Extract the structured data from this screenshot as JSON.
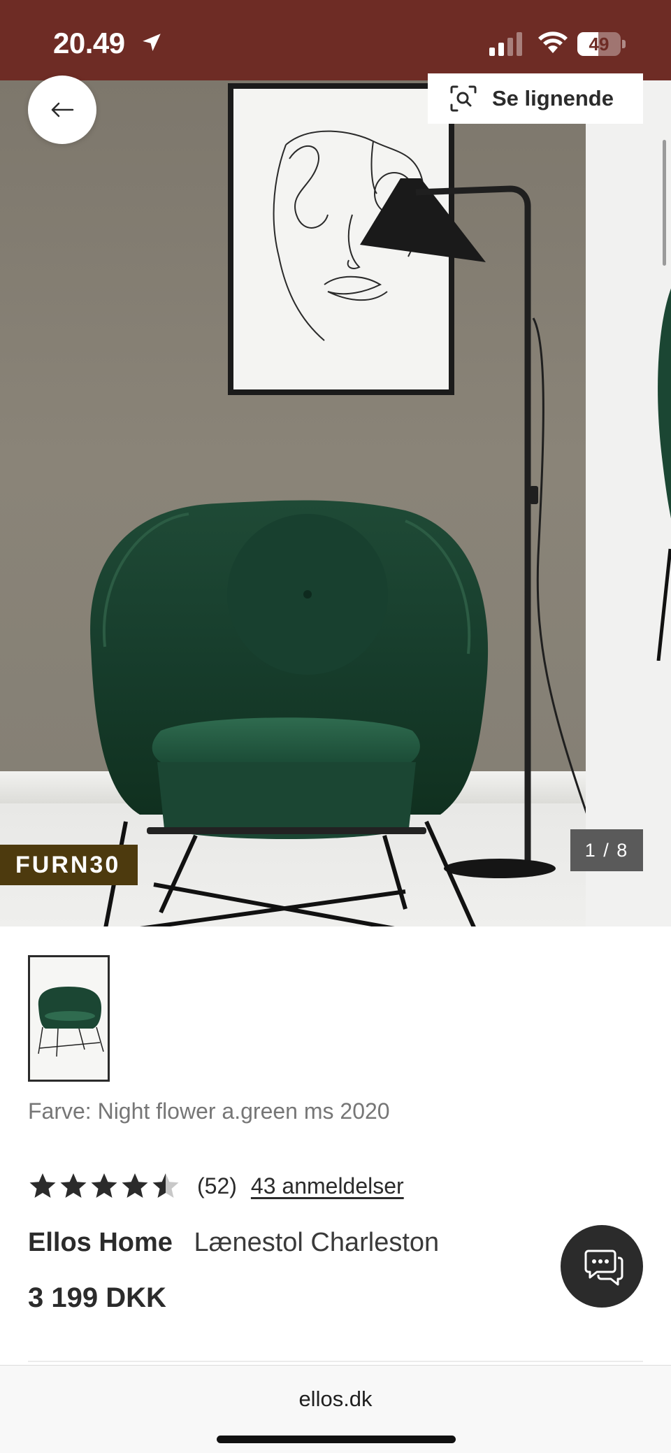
{
  "status_bar": {
    "time": "20.49",
    "battery_percent": "49",
    "battery_level": 0.49,
    "background_color": "#6e2c25",
    "icons": [
      "location-arrow-icon",
      "signal-icon",
      "wifi-icon",
      "battery-icon"
    ]
  },
  "gallery": {
    "back_icon": "arrow-left-icon",
    "similar_label": "Se lignende",
    "similar_icon": "visual-search-icon",
    "promo_code": "FURN30",
    "counter": "1 / 8",
    "current_index": 1,
    "total": 8
  },
  "product": {
    "color_label": "Farve: Night flower a.green ms 2020",
    "rating_value": 4.5,
    "rating_count": "(52)",
    "reviews_link": "43 anmeldelser",
    "brand": "Ellos Home",
    "name": "Lænestol Charleston",
    "price": "3 199 DKK"
  },
  "chat": {
    "icon": "chat-bubbles-icon"
  },
  "browser": {
    "url": "ellos.dk"
  },
  "colors": {
    "accent": "#6e2c25",
    "promo_badge": "#4d3a0e",
    "text": "#2b2b2b",
    "muted": "#767676"
  }
}
